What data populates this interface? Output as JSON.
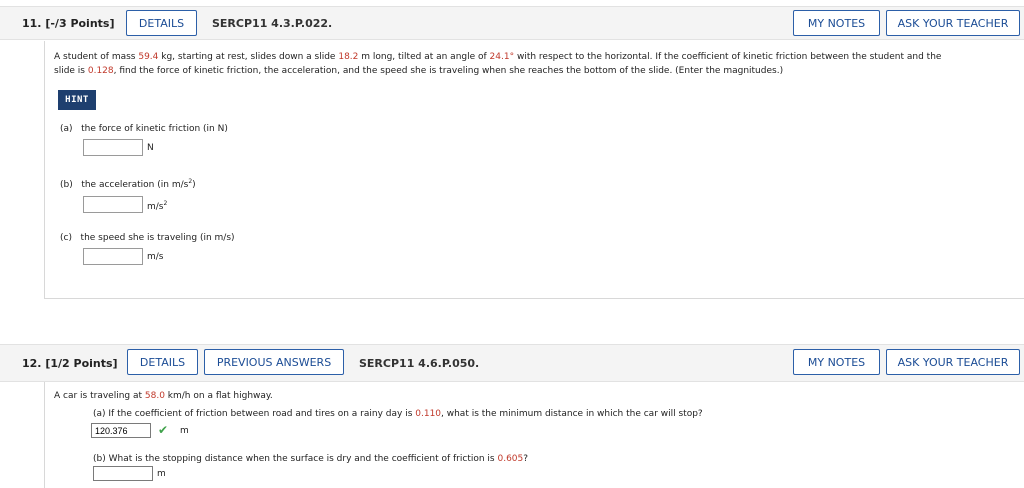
{
  "q11": {
    "number": "11.",
    "points": "[-/3 Points]",
    "details_label": "DETAILS",
    "code": "SERCP11 4.3.P.022.",
    "my_notes_label": "MY NOTES",
    "ask_teacher_label": "ASK YOUR TEACHER",
    "problem": {
      "t1": "A student of mass ",
      "mass": "59.4",
      "t2": " kg, starting at rest, slides down a slide ",
      "length": "18.2",
      "t3": " m long, tilted at an angle of ",
      "angle": "24.1°",
      "t4": " with respect to the horizontal. If the coefficient of kinetic friction between the student and the",
      "t5": "slide is ",
      "coef": "0.128",
      "t6": ", find the force of kinetic friction, the acceleration, and the speed she is traveling when she reaches the bottom of the slide. (Enter the magnitudes.)"
    },
    "hint_label": "HINT",
    "parts": [
      {
        "label": "(a)   the force of kinetic friction (in N)",
        "unit": "N",
        "value": ""
      },
      {
        "label_pre": "(b)   the acceleration (in m/s",
        "label_post": ")",
        "sup": "2",
        "unit": "m/s",
        "unit_sup": "2",
        "value": ""
      },
      {
        "label": "(c)   the speed she is traveling (in m/s)",
        "unit": "m/s",
        "value": ""
      }
    ]
  },
  "q12": {
    "number": "12.",
    "points": "[1/2 Points]",
    "details_label": "DETAILS",
    "prev_answers_label": "PREVIOUS ANSWERS",
    "code": "SERCP11 4.6.P.050.",
    "my_notes_label": "MY NOTES",
    "ask_teacher_label": "ASK YOUR TEACHER",
    "intro": {
      "t1": "A car is traveling at ",
      "speed": "58.0",
      "t2": " km/h on a flat highway."
    },
    "part_a": {
      "t1": "(a) If the coefficient of friction between road and tires on a rainy day is ",
      "coef": "0.110",
      "t2": ", what is the minimum distance in which the car will stop?",
      "value": "120.376",
      "unit": "m"
    },
    "part_b": {
      "t1": "(b) What is the stopping distance when the surface is dry and the coefficient of friction is ",
      "coef": "0.605",
      "t2": "?",
      "value": "",
      "unit": "m"
    }
  }
}
